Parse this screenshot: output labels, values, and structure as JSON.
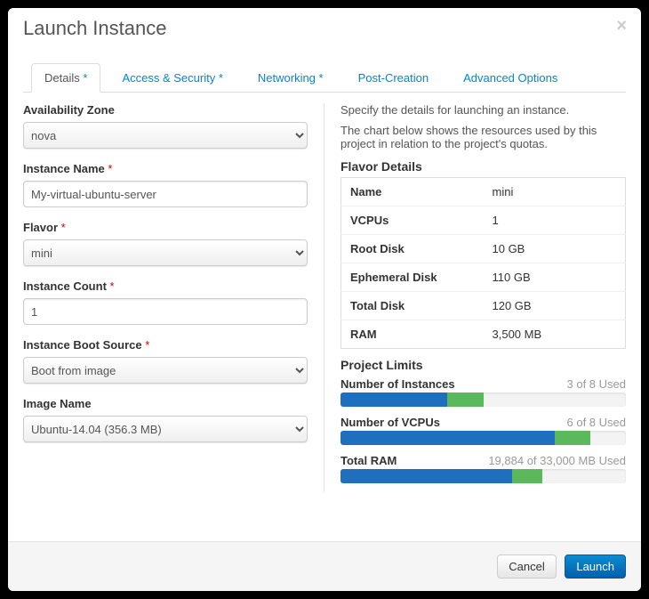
{
  "header": {
    "title": "Launch Instance"
  },
  "tabs": [
    {
      "label": "Details",
      "required": "*",
      "active": true
    },
    {
      "label": "Access & Security",
      "required": "*"
    },
    {
      "label": "Networking",
      "required": "*"
    },
    {
      "label": "Post-Creation",
      "required": ""
    },
    {
      "label": "Advanced Options",
      "required": ""
    }
  ],
  "form": {
    "availability_zone": {
      "label": "Availability Zone",
      "value": "nova"
    },
    "instance_name": {
      "label": "Instance Name",
      "required": "*",
      "value": "My-virtual-ubuntu-server"
    },
    "flavor": {
      "label": "Flavor",
      "required": "*",
      "value": "mini"
    },
    "instance_count": {
      "label": "Instance Count",
      "required": "*",
      "value": "1"
    },
    "boot_source": {
      "label": "Instance Boot Source",
      "required": "*",
      "value": "Boot from image"
    },
    "image_name": {
      "label": "Image Name",
      "value": "Ubuntu-14.04 (356.3 MB)"
    }
  },
  "info": {
    "p1": "Specify the details for launching an instance.",
    "p2": "The chart below shows the resources used by this project in relation to the project's quotas.",
    "flavor_title": "Flavor Details",
    "flavor": {
      "name_k": "Name",
      "name_v": "mini",
      "vcpus_k": "VCPUs",
      "vcpus_v": "1",
      "root_k": "Root Disk",
      "root_v": "10 GB",
      "eph_k": "Ephemeral Disk",
      "eph_v": "110 GB",
      "total_k": "Total Disk",
      "total_v": "120 GB",
      "ram_k": "RAM",
      "ram_v": "3,500 MB"
    },
    "limits_title": "Project Limits",
    "limits": {
      "instances": {
        "label": "Number of Instances",
        "text": "3 of 8 Used",
        "used_pct": 37.5,
        "new_pct": 12.5
      },
      "vcpus": {
        "label": "Number of VCPUs",
        "text": "6 of 8 Used",
        "used_pct": 75,
        "new_pct": 12.5
      },
      "ram": {
        "label": "Total RAM",
        "text": "19,884 of 33,000 MB Used",
        "used_pct": 60.25,
        "new_pct": 10.6
      }
    }
  },
  "footer": {
    "cancel": "Cancel",
    "launch": "Launch"
  }
}
